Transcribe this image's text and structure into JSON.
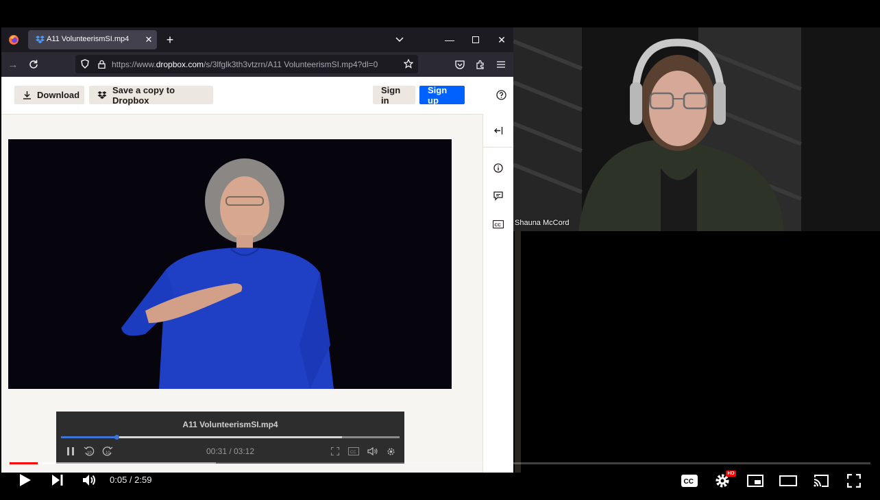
{
  "browser": {
    "tab_title": "A11 VolunteerismSI.mp4",
    "url_prefix": "https://www.",
    "url_domain": "dropbox.com",
    "url_rest": "/s/3lfglk3th3vtzrn/A11 VolunteerismSI.mp4?dl=0"
  },
  "dropbox": {
    "download_label": "Download",
    "save_label": "Save a copy to Dropbox",
    "signin_label": "Sign in",
    "signup_label": "Sign up",
    "player": {
      "title": "A11 VolunteerismSI.mp4",
      "time": "00:31 / 03:12",
      "progress_fraction": 0.163,
      "buffered_fraction": 0.83
    }
  },
  "webcam": {
    "participant_name": "Shauna McCord"
  },
  "youtube": {
    "time": "0:05 / 2:59",
    "progress_fraction": 0.033,
    "buffered_fraction": 0.24,
    "hd_badge": "HD"
  },
  "colors": {
    "dropbox_blue": "#0061fe",
    "yt_red": "#ff0000",
    "firefox_tab": "#42414d"
  }
}
